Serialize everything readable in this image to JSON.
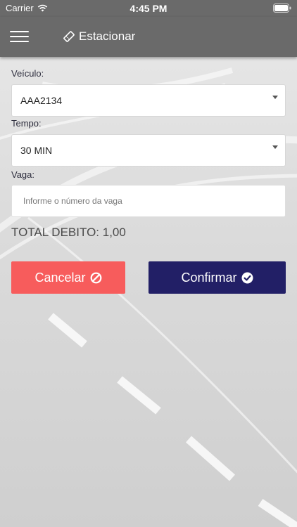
{
  "status_bar": {
    "carrier": "Carrier",
    "time": "4:45 PM",
    "icons": [
      "wifi-icon",
      "battery-icon"
    ]
  },
  "nav": {
    "title": "Estacionar",
    "icons": [
      "menu-icon",
      "ticket-icon"
    ]
  },
  "form": {
    "vehicle_label": "Veículo:",
    "vehicle_value": "AAA2134",
    "time_label": "Tempo:",
    "time_value": "30 MIN",
    "spot_label": "Vaga:",
    "spot_placeholder": "Informe o número da vaga",
    "total": "TOTAL DEBITO: 1,00"
  },
  "actions": {
    "cancel_label": "Cancelar",
    "cancel_icon": "ban-icon",
    "confirm_label": "Confirmar",
    "confirm_icon": "check-circle-icon"
  },
  "colors": {
    "header": "#6a6a6a",
    "cancel": "#f75c5c",
    "confirm": "#221f66"
  }
}
